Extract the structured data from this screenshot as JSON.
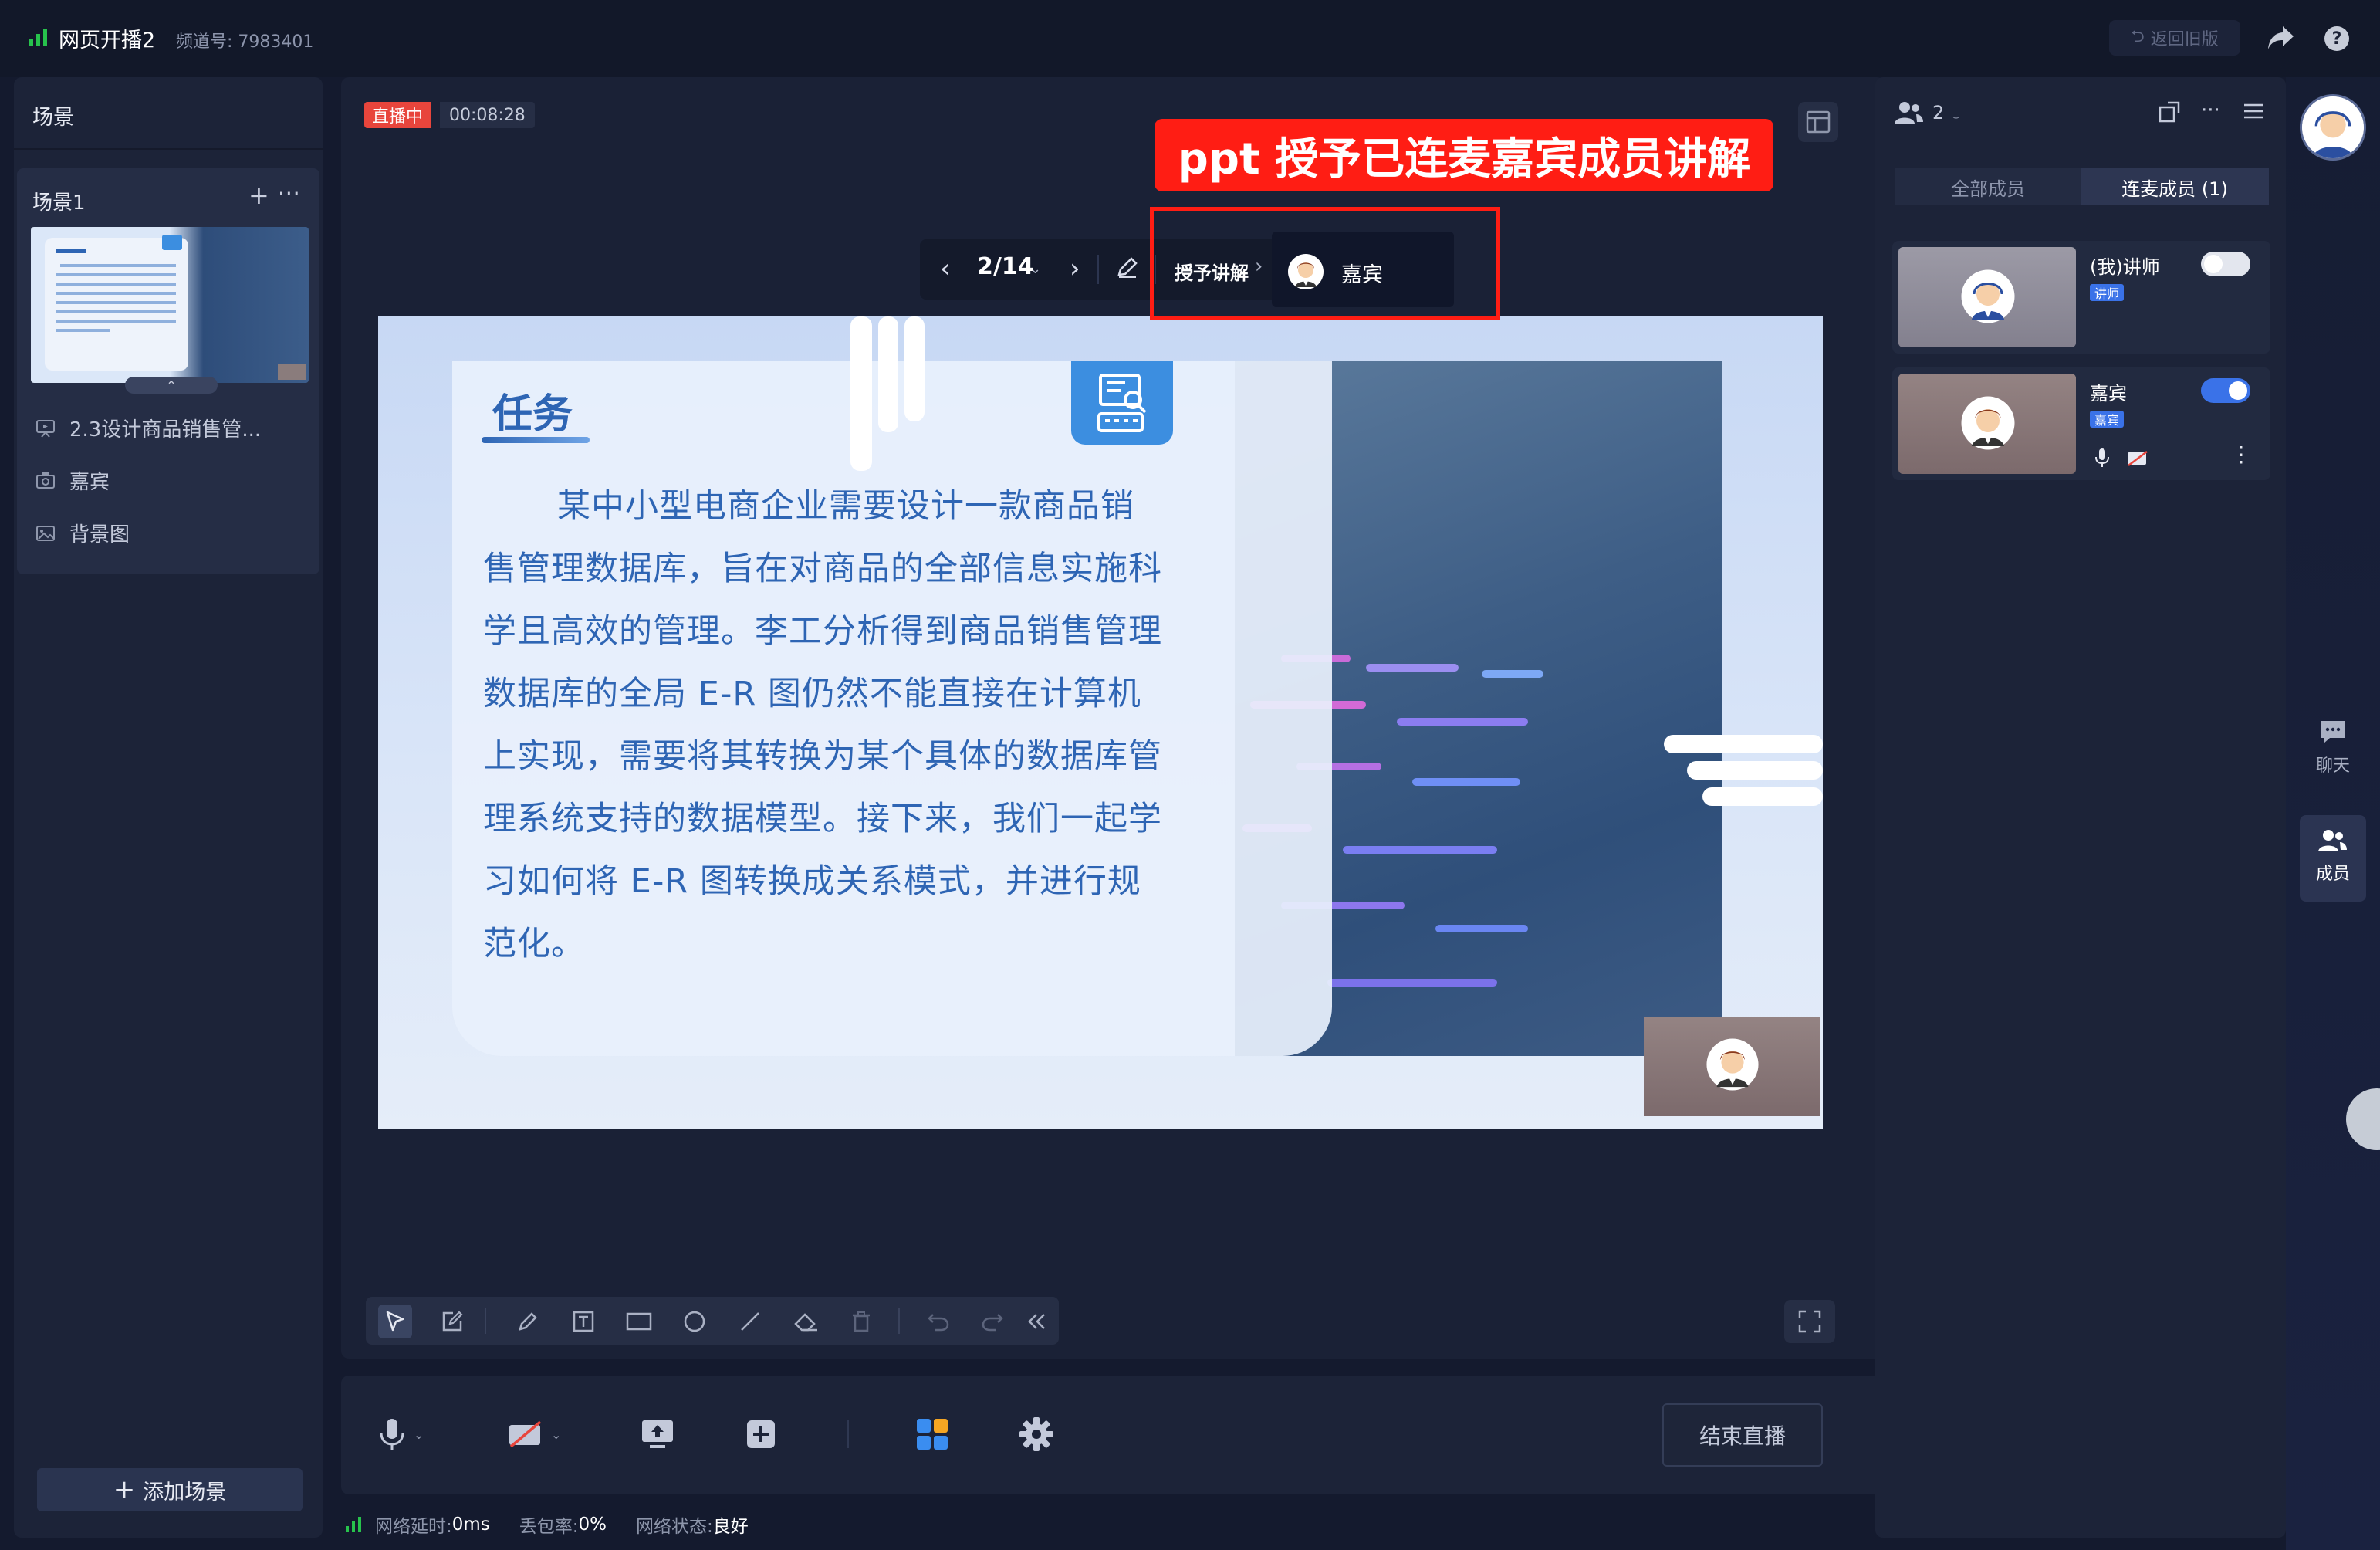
{
  "app": {
    "title": "网页开播2",
    "channel": "频道号: 7983401",
    "back_old": "返回旧版",
    "help": "?"
  },
  "scenes": {
    "panel_title": "场景",
    "scene_name": "场景1",
    "add_icon": "+",
    "more_icon": "···",
    "collapse_icon": "⌃",
    "items": [
      {
        "icon": "ppt-icon",
        "label": "2.3设计商品销售管..."
      },
      {
        "icon": "camera-icon",
        "label": "嘉宾"
      },
      {
        "icon": "image-icon",
        "label": "背景图"
      }
    ],
    "add_scene": "添加场景"
  },
  "live": {
    "badge": "直播中",
    "timer": "00:08:28"
  },
  "annotation": "ppt 授予已连麦嘉宾成员讲解",
  "ppt_bar": {
    "prev": "‹",
    "page": "2/14",
    "page_caret": "⌄",
    "next": "›",
    "grant_label": "授予讲解",
    "grant_chevron": "›",
    "grant_member": "嘉宾"
  },
  "slide": {
    "heading": "任务",
    "body": "某中小型电商企业需要设计一款商品销售管理数据库，旨在对商品的全部信息实施科学且高效的管理。李工分析得到商品销售管理数据库的全局 E-R 图仍然不能直接在计算机上实现，需要将其转换为某个具体的数据库管理系统支持的数据模型。接下来，我们一起学习如何将 E-R 图转换成关系模式，并进行规范化。"
  },
  "toolbar": {
    "tools": [
      "select-tool",
      "edit-tool",
      "pen-tool",
      "text-tool",
      "rectangle-tool",
      "circle-tool",
      "line-tool",
      "eraser-tool",
      "delete-tool",
      "undo-tool",
      "redo-tool",
      "collapse-tool"
    ]
  },
  "controls": {
    "end_live": "结束直播",
    "caret": "⌄"
  },
  "status": {
    "latency_label": "网络延时: ",
    "latency_value": "0ms",
    "loss_label": "丢包率: ",
    "loss_value": "0%",
    "state_label": "网络状态: ",
    "state_value": "良好"
  },
  "members": {
    "count": "2",
    "more_icon": "···",
    "tabs": [
      "全部成员",
      "连麦成员 (1)"
    ],
    "list": [
      {
        "name": "(我)讲师",
        "role": "讲师",
        "enabled": false
      },
      {
        "name": "嘉宾",
        "role": "嘉宾",
        "enabled": true,
        "more": "⋮"
      }
    ]
  },
  "rail": {
    "chat": "聊天",
    "members": "成员"
  },
  "colors": {
    "accent_blue": "#3a72e8",
    "live_red": "#e8453c",
    "annotation_red": "#ff1d14",
    "slide_blue": "#2e65b4",
    "signal_green": "#27c24c"
  }
}
